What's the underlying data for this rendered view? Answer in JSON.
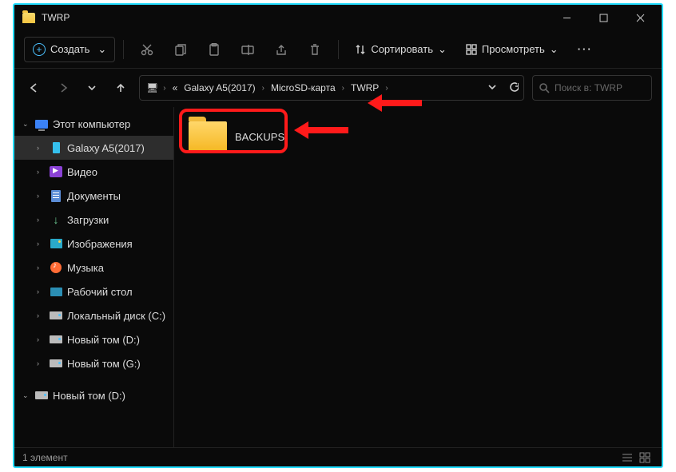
{
  "titlebar": {
    "title": "TWRP"
  },
  "toolbar": {
    "new_label": "Создать",
    "sort_label": "Сортировать",
    "view_label": "Просмотреть"
  },
  "breadcrumbs": {
    "b0": "«",
    "b1": "Galaxy A5(2017)",
    "b2": "MicroSD-карта",
    "b3": "TWRP"
  },
  "search": {
    "placeholder": "Поиск в: TWRP"
  },
  "sidebar": {
    "root": "Этот компьютер",
    "items": [
      "Galaxy A5(2017)",
      "Видео",
      "Документы",
      "Загрузки",
      "Изображения",
      "Музыка",
      "Рабочий стол",
      "Локальный диск (C:)",
      "Новый том (D:)",
      "Новый том (G:)"
    ],
    "group2": "Новый том (D:)"
  },
  "content": {
    "folder0": "BACKUPS"
  },
  "status": {
    "count": "1 элемент"
  }
}
